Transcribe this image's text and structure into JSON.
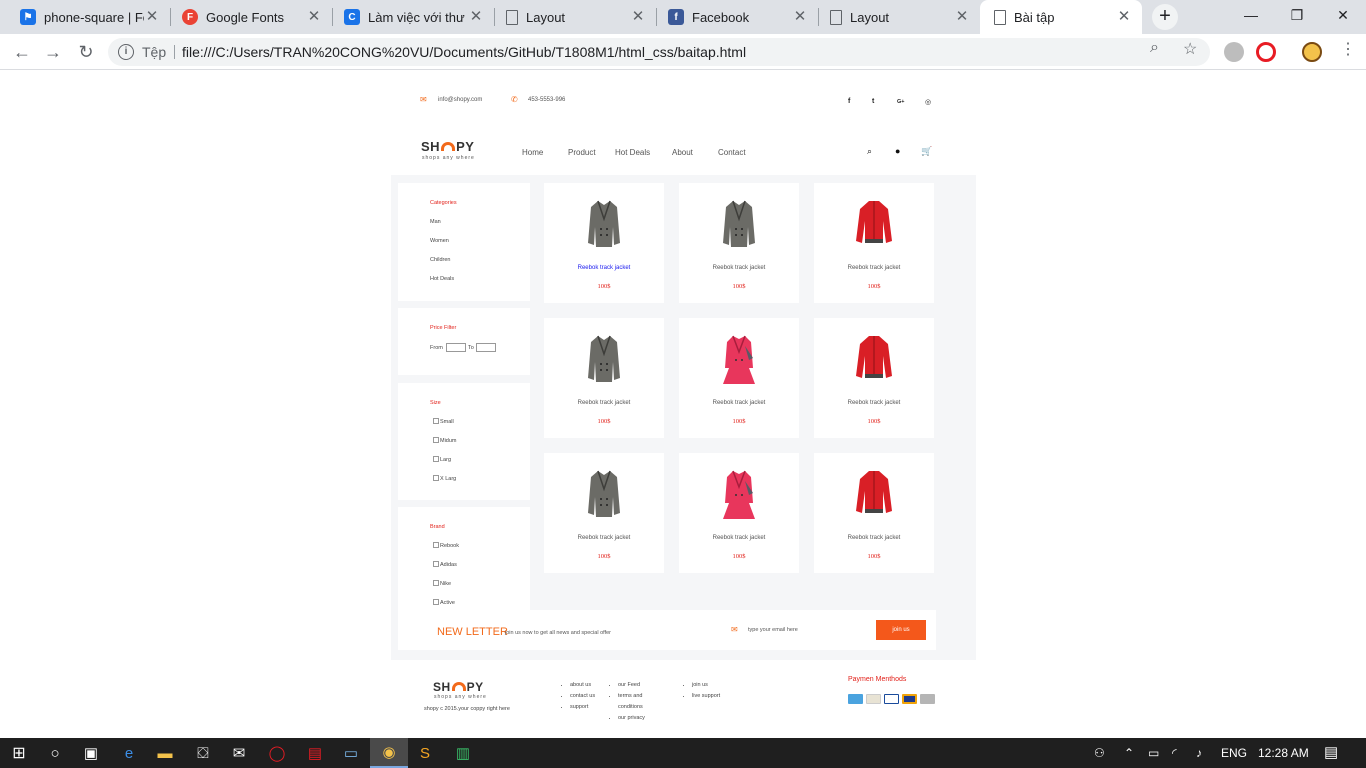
{
  "browser": {
    "tabs": [
      {
        "title": "phone-square | Fo",
        "icon": "flag-icon",
        "color": "#1a73e8"
      },
      {
        "title": "Google Fonts",
        "icon": "google-fonts-icon",
        "color": "#ea4335"
      },
      {
        "title": "Làm việc với thư v",
        "icon": "c-icon",
        "color": "#1a73e8"
      },
      {
        "title": "Layout",
        "icon": "document-icon",
        "color": "#5f6368"
      },
      {
        "title": "Facebook",
        "icon": "facebook-icon",
        "color": "#3b5998"
      },
      {
        "title": "Layout",
        "icon": "document-icon",
        "color": "#5f6368"
      },
      {
        "title": "Bài tập",
        "icon": "document-icon",
        "color": "#5f6368",
        "active": true
      }
    ],
    "security_label": "Tệp",
    "url": "file:///C:/Users/TRAN%20CONG%20VU/Documents/GitHub/T1808M1/html_css/baitap.html"
  },
  "page": {
    "topbar": {
      "email": "info@shopy.com",
      "phone": "453-5553-996",
      "social": [
        "f",
        "t",
        "G+",
        "◎"
      ]
    },
    "logo": {
      "left": "SH",
      "right": "PY",
      "tagline": "shops any where"
    },
    "nav": [
      "Home",
      "Product",
      "Hot Deals",
      "About",
      "Contact"
    ],
    "sidebar": {
      "categories": {
        "title": "Categories",
        "items": [
          "Man",
          "Women",
          "Children",
          "Hot Deals"
        ]
      },
      "price": {
        "title": "Price Filter",
        "from": "From",
        "to": "To"
      },
      "size": {
        "title": "Size",
        "items": [
          "Small",
          "Midum",
          "Larg",
          "X Larg"
        ]
      },
      "brand": {
        "title": "Brand",
        "items": [
          "Rebook",
          "Adidas",
          "Nike",
          "Active"
        ]
      }
    },
    "products": [
      {
        "name": "Reebok track jacket",
        "price": "100$",
        "image": "grey-coat",
        "link": true
      },
      {
        "name": "Reebok track jacket",
        "price": "100$",
        "image": "grey-coat"
      },
      {
        "name": "Reebok track jacket",
        "price": "100$",
        "image": "red-jacket"
      },
      {
        "name": "Reebok track jacket",
        "price": "100$",
        "image": "grey-coat"
      },
      {
        "name": "Reebok track jacket",
        "price": "100$",
        "image": "pink-coat"
      },
      {
        "name": "Reebok track jacket",
        "price": "100$",
        "image": "red-jacket"
      },
      {
        "name": "Reebok track jacket",
        "price": "100$",
        "image": "grey-coat"
      },
      {
        "name": "Reebok track jacket",
        "price": "100$",
        "image": "pink-coat"
      },
      {
        "name": "Reebok track jacket",
        "price": "100$",
        "image": "red-jacket"
      }
    ],
    "newsletter": {
      "title": "NEW LETTER",
      "subtitle": "join us now to get all news and special offer",
      "placeholder": "type your email here",
      "button": "join us"
    },
    "footer": {
      "copyright": "shopy c 2015.your coppy right here",
      "col1": [
        "about us",
        "contact us",
        "support"
      ],
      "col2": [
        "our Feed",
        "terms and conditions",
        "our privacy"
      ],
      "col3": [
        "join us",
        "live support"
      ],
      "payment_title": "Paymen Menthods"
    }
  },
  "taskbar": {
    "language": "ENG",
    "time": "12:28 AM"
  },
  "colors": {
    "accent": "#f26a1b",
    "red": "#e2221b"
  }
}
